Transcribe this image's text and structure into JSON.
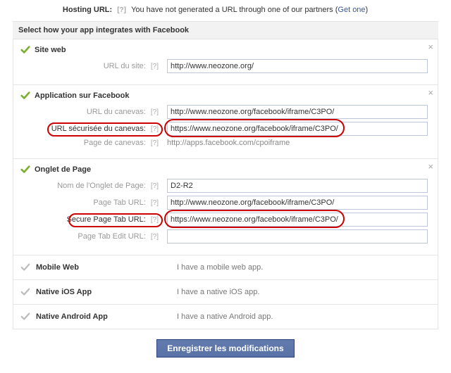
{
  "top": {
    "hosting_label": "Hosting URL:",
    "help": "[?]",
    "hosting_desc_pre": "You have not generated a URL through one of our partners (",
    "hosting_link": "Get one",
    "hosting_desc_post": ")"
  },
  "section_header": "Select how your app integrates with Facebook",
  "groups": {
    "site_web": {
      "title": "Site web",
      "rows": {
        "url_site": {
          "label": "URL du site:",
          "value": "http://www.neozone.org/"
        }
      }
    },
    "app_fb": {
      "title": "Application sur Facebook",
      "rows": {
        "canvas_url": {
          "label": "URL du canevas:",
          "value": "http://www.neozone.org/facebook/iframe/C3PO/"
        },
        "secure_canvas_url": {
          "label": "URL sécurisée du canevas:",
          "value": "https://www.neozone.org/facebook/iframe/C3PO/"
        },
        "canvas_page": {
          "label": "Page de canevas:",
          "value": "http://apps.facebook.com/cpoiframe"
        }
      }
    },
    "page_tab": {
      "title": "Onglet de Page",
      "rows": {
        "tab_name": {
          "label": "Nom de l'Onglet de Page:",
          "value": "D2-R2"
        },
        "tab_url": {
          "label": "Page Tab URL:",
          "value": "http://www.neozone.org/facebook/iframe/C3PO/"
        },
        "secure_tab_url": {
          "label": "Secure Page Tab URL:",
          "value": "https://www.neozone.org/facebook/iframe/C3PO/"
        },
        "tab_edit_url": {
          "label": "Page Tab Edit URL:",
          "value": ""
        }
      }
    }
  },
  "collapsed": {
    "mobile": {
      "title": "Mobile Web",
      "desc": "I have a mobile web app."
    },
    "ios": {
      "title": "Native iOS App",
      "desc": "I have a native iOS app."
    },
    "android": {
      "title": "Native Android App",
      "desc": "I have a native Android app."
    }
  },
  "save_button": "Enregistrer les modifications",
  "close_x": "×"
}
